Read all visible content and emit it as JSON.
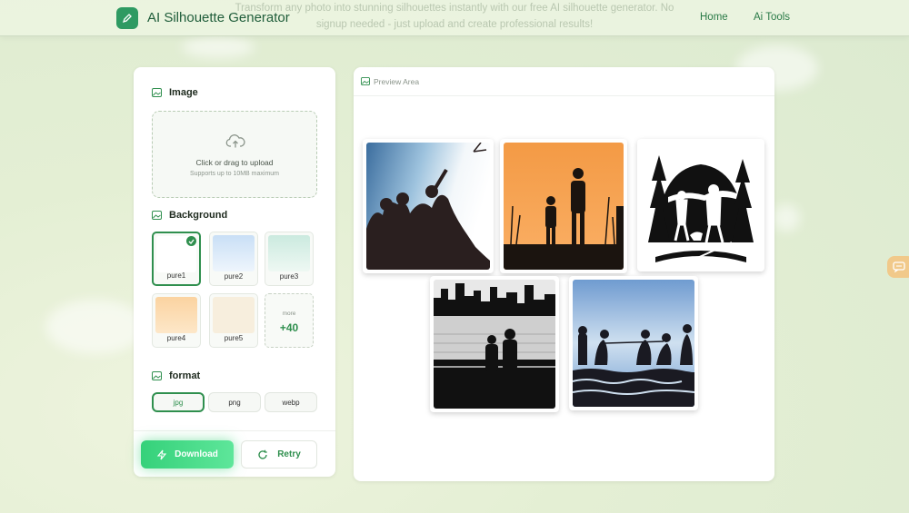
{
  "header": {
    "app_title": "AI Silhouette Generator",
    "tagline": "Transform any photo into stunning silhouettes instantly with our free AI silhouette generator. No signup needed - just upload and create professional results!",
    "nav": [
      "Home",
      "Ai Tools"
    ]
  },
  "left_panel": {
    "image_section": {
      "title": "Image",
      "upload_text": "Click or drag to upload",
      "upload_hint": "Supports up to 10MB maximum"
    },
    "background_section": {
      "title": "Background",
      "options": [
        {
          "label": "pure1",
          "color": "#ffffff",
          "selected": true
        },
        {
          "label": "pure2",
          "color": "#d7e7f8"
        },
        {
          "label": "pure3",
          "color": "#d6efe6"
        },
        {
          "label": "pure4",
          "color": "#fbd9a8"
        },
        {
          "label": "pure5",
          "color": "#f7eedd"
        }
      ],
      "more": {
        "label": "more",
        "count": "+40"
      }
    },
    "format_section": {
      "title": "format",
      "options": [
        "jpg",
        "png",
        "webp"
      ],
      "selected": "jpg"
    },
    "actions": {
      "download": "Download",
      "retry": "Retry"
    }
  },
  "preview": {
    "title": "Preview Area",
    "images": [
      "people-cheering-silhouette",
      "sunset-walkers-silhouette",
      "hikers-with-dog-silhouette",
      "city-couple-silhouette",
      "tug-of-war-silhouette"
    ]
  },
  "colors": {
    "accent": "#2f8f4e",
    "download_gradient": "#35d17a"
  }
}
